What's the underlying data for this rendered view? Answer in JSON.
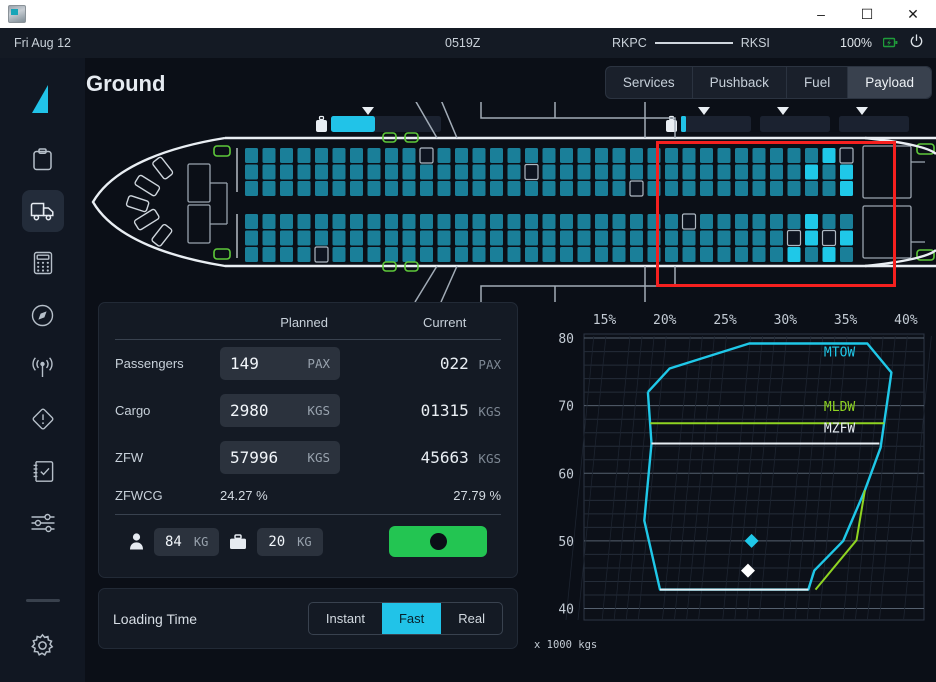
{
  "window": {
    "app_icon": "app-icon",
    "minimize": "–",
    "maximize": "☐",
    "close": "✕"
  },
  "statusbar": {
    "date": "Fri Aug 12",
    "time": "0519Z",
    "origin": "RKPC",
    "destination": "RKSI",
    "battery_pct": "100%",
    "battery_icon": "battery-charging-icon",
    "power_icon": "power-icon"
  },
  "header": {
    "title": "Ground",
    "logo": "tailfin-logo"
  },
  "tabs": [
    {
      "label": "Services",
      "active": false
    },
    {
      "label": "Pushback",
      "active": false
    },
    {
      "label": "Fuel",
      "active": false
    },
    {
      "label": "Payload",
      "active": true
    }
  ],
  "sidebar": {
    "items": [
      {
        "name": "clipboard-icon",
        "active": false
      },
      {
        "name": "truck-icon",
        "active": true
      },
      {
        "name": "calculator-icon",
        "active": false
      },
      {
        "name": "compass-icon",
        "active": false
      },
      {
        "name": "antenna-icon",
        "active": false
      },
      {
        "name": "warning-icon",
        "active": false
      },
      {
        "name": "checklist-icon",
        "active": false
      },
      {
        "name": "sliders-icon",
        "active": false
      }
    ],
    "settings_icon": "gear-icon"
  },
  "payload_table": {
    "col_planned": "Planned",
    "col_current": "Current",
    "rows": [
      {
        "label": "Passengers",
        "planned_value": "149",
        "planned_unit": "PAX",
        "current_value": "022",
        "current_unit": "PAX"
      },
      {
        "label": "Cargo",
        "planned_value": "2980",
        "planned_unit": "KGS",
        "current_value": "01315",
        "current_unit": "KGS"
      },
      {
        "label": "ZFW",
        "planned_value": "57996",
        "planned_unit": "KGS",
        "current_value": "45663",
        "current_unit": "KGS"
      }
    ],
    "cg_row": {
      "label": "ZFWCG",
      "planned": "24.27 %",
      "current": "27.79 %"
    }
  },
  "weights": {
    "pax_icon": "person-icon",
    "pax_weight": "84",
    "pax_unit": "KG",
    "bag_icon": "briefcase-icon",
    "bag_weight": "20",
    "bag_unit": "KG",
    "start_button": "start-loading-button"
  },
  "loading_time": {
    "label": "Loading Time",
    "options": [
      {
        "label": "Instant",
        "active": false
      },
      {
        "label": "Fast",
        "active": true
      },
      {
        "label": "Real",
        "active": false
      }
    ]
  },
  "cargo_bars": {
    "forward": {
      "icon": "briefcase-icon",
      "fill_pct": 28,
      "marker_pct": 42
    },
    "aft": [
      {
        "icon": "briefcase-icon",
        "fill_pct": 6,
        "marker_pct": 42
      },
      {
        "fill_pct": 0,
        "marker_pct": 43
      },
      {
        "fill_pct": 0,
        "marker_pct": 43
      }
    ]
  },
  "selection_box": {
    "color": "#f5201f",
    "name": "aft-cabin-selection"
  },
  "colors": {
    "seat_normal": "#1a7f99",
    "seat_highlight": "#1fc8e8",
    "accent": "#21c3e8",
    "green": "#23c552",
    "lime": "#8fd422",
    "red": "#f5201f"
  },
  "chart_data": {
    "type": "line",
    "title": "",
    "xlabel": "",
    "ylabel": "x 1000 kgs",
    "xlim": [
      13.3,
      41.5
    ],
    "ylim": [
      38.3,
      80.6
    ],
    "x_ticks": [
      "15%",
      "20%",
      "25%",
      "30%",
      "35%",
      "40%"
    ],
    "x_tick_values": [
      15,
      20,
      25,
      30,
      35,
      40
    ],
    "y_ticks": [
      "40",
      "50",
      "60",
      "70",
      "80"
    ],
    "y_tick_values": [
      40,
      50,
      60,
      70,
      80
    ],
    "grid": true,
    "legend": "none",
    "series": [
      {
        "name": "MTOW",
        "label": "MTOW",
        "color": "#1fc8e8",
        "type": "envelope",
        "points": [
          [
            18.6,
            72.0
          ],
          [
            20.4,
            75.5
          ],
          [
            27.0,
            79.2
          ],
          [
            36.8,
            79.2
          ],
          [
            38.8,
            74.9
          ],
          [
            37.9,
            63.8
          ],
          [
            36.6,
            57.5
          ],
          [
            34.8,
            50.0
          ],
          [
            32.4,
            45.6
          ],
          [
            31.9,
            42.8
          ],
          [
            19.6,
            42.8
          ],
          [
            18.3,
            53.0
          ],
          [
            18.9,
            64.4
          ],
          [
            18.6,
            72.0
          ]
        ]
      },
      {
        "name": "MLDW",
        "label": "MLDW",
        "color": "#8fd422",
        "type": "line",
        "points": [
          [
            18.8,
            67.4
          ],
          [
            38.2,
            67.4
          ]
        ]
      },
      {
        "name": "MLDW-right-boundary",
        "color": "#8fd422",
        "type": "line",
        "points": [
          [
            36.6,
            57.5
          ],
          [
            35.9,
            50.1
          ],
          [
            32.5,
            42.8
          ]
        ]
      },
      {
        "name": "MZFW",
        "label": "MZFW",
        "color": "#e8eef3",
        "type": "line",
        "points": [
          [
            18.9,
            64.4
          ],
          [
            37.8,
            64.4
          ]
        ]
      },
      {
        "name": "MZFW-floor",
        "color": "#e8eef3",
        "type": "line",
        "points": [
          [
            19.6,
            42.8
          ],
          [
            31.9,
            42.8
          ]
        ]
      }
    ],
    "markers": [
      {
        "name": "planned-cg",
        "x": 27.2,
        "y": 50.0,
        "color": "#1fc8e8",
        "shape": "diamond"
      },
      {
        "name": "current-cg",
        "x": 26.9,
        "y": 45.6,
        "color": "#ffffff",
        "shape": "diamond"
      }
    ]
  }
}
